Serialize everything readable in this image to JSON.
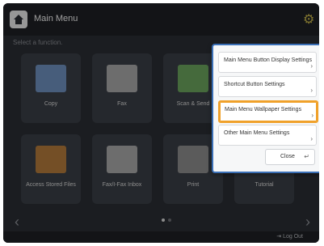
{
  "header": {
    "title": "Main Menu",
    "subtitle": "Select a function."
  },
  "tiles": [
    {
      "label": "Copy",
      "icon": "copy-icon"
    },
    {
      "label": "Fax",
      "icon": "fax-icon"
    },
    {
      "label": "Scan & Send",
      "icon": "scan-send-icon"
    },
    {
      "label": "",
      "icon": "blank-icon"
    },
    {
      "label": "Access Stored Files",
      "icon": "stored-files-icon"
    },
    {
      "label": "Fax/I-Fax Inbox",
      "icon": "fax-inbox-icon"
    },
    {
      "label": "Print",
      "icon": "print-icon"
    },
    {
      "label": "Tutorial",
      "icon": "tutorial-icon"
    }
  ],
  "popup": {
    "items": [
      {
        "label": "Main Menu Button Display Settings"
      },
      {
        "label": "Shortcut Button Settings"
      },
      {
        "label": "Main Menu Wallpaper Settings"
      },
      {
        "label": "Other Main Menu Settings"
      }
    ],
    "close_label": "Close"
  },
  "footer": {
    "logout_label": "Log Out"
  },
  "colors": {
    "highlight": "#f0a12a",
    "accent": "#3a6fb6"
  }
}
